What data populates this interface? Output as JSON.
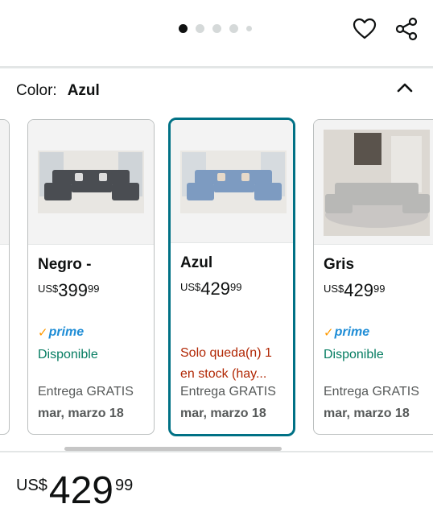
{
  "gallery": {
    "dot_count": 5,
    "active_index": 0
  },
  "color": {
    "label": "Color:",
    "selected": "Azul"
  },
  "variants": [
    {
      "name": "Negro -",
      "currency": "US$",
      "price_whole": "399",
      "price_fraction": "99",
      "prime": "prime",
      "availability": "Disponible",
      "shipping": "Entrega GRATIS",
      "delivery_date": "mar, marzo 18",
      "sofa_color": "#4a4d52"
    },
    {
      "name": "Azul",
      "currency": "US$",
      "price_whole": "429",
      "price_fraction": "99",
      "availability_line1": "Solo queda(n) 1",
      "availability_line2": "en stock (hay...",
      "shipping": "Entrega GRATIS",
      "delivery_date": "mar, marzo 18",
      "sofa_color": "#7d9bc1"
    },
    {
      "name": "Gris",
      "currency": "US$",
      "price_whole": "429",
      "price_fraction": "99",
      "prime": "prime",
      "availability": "Disponible",
      "shipping": "Entrega GRATIS",
      "delivery_date": "mar, marzo 18",
      "sofa_color": "#b8b8b6"
    }
  ],
  "price": {
    "currency": "US$",
    "whole": "429",
    "fraction": "99"
  },
  "colors": {
    "selected_border": "#007185",
    "available": "#067d62",
    "low_stock": "#b12704",
    "prime_blue": "#1f8dd6",
    "prime_check": "#ff9900"
  }
}
